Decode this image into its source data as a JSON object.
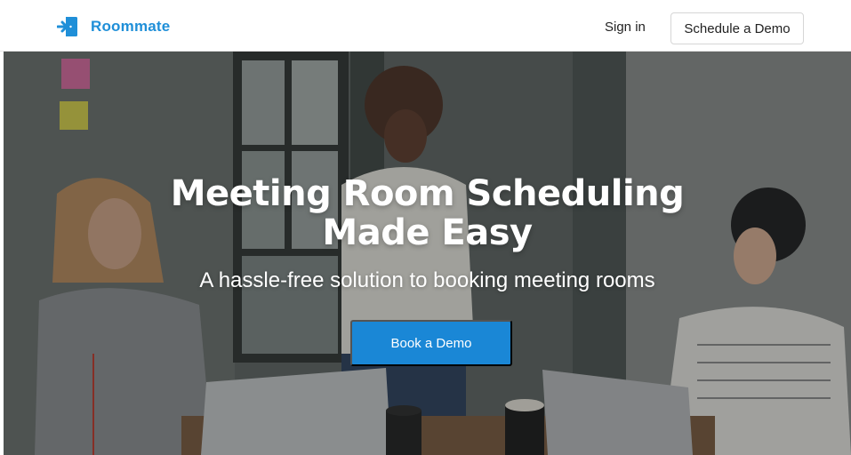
{
  "nav": {
    "brand_name": "Roommate",
    "signin_label": "Sign in",
    "schedule_demo_label": "Schedule a Demo",
    "logo_icon": "door-enter-icon"
  },
  "hero": {
    "headline_line1": "Meeting Room Scheduling",
    "headline_line2": "Made Easy",
    "subheadline": "A hassle-free solution to booking meeting rooms",
    "cta_label": "Book a Demo",
    "background": "photo of three people in a meeting room with laptops and coffee cups"
  },
  "colors": {
    "brand_blue": "#1f8fd8",
    "cta_blue": "#1a87d6"
  }
}
